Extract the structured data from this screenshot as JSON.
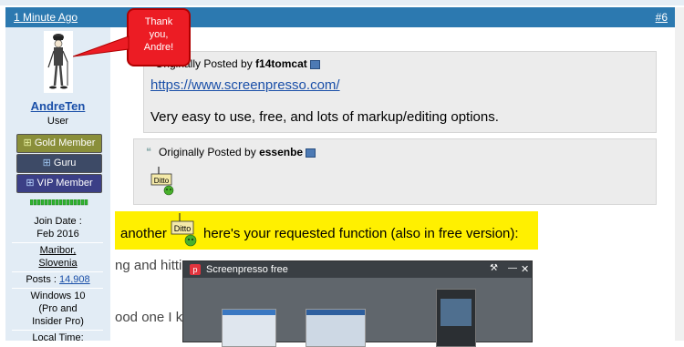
{
  "post": {
    "timestamp": "1 Minute Ago",
    "number": "#6"
  },
  "callout": {
    "lines": [
      "Thank",
      "you,",
      "Andre!"
    ]
  },
  "user": {
    "name": "AndreTen",
    "role": "User",
    "badges": [
      {
        "label": "Gold Member",
        "color": "#8a8f3a"
      },
      {
        "label": "Guru",
        "color": "#3d4a66"
      },
      {
        "label": "VIP Member",
        "color": "#3b3f86"
      }
    ],
    "join_label": "Join Date :",
    "join_value": "Feb 2016",
    "location_1": "Maribor,",
    "location_2": "Slovenia",
    "posts_label": "Posts :",
    "posts_value": "14,908",
    "os_1": "Windows 10",
    "os_2": "(Pro and",
    "os_3": "Insider Pro)",
    "local_time": "Local Time:"
  },
  "quote1": {
    "prefix": "Originally Posted by",
    "author": "f14tomcat",
    "link": "https://www.screenpresso.com/",
    "text": "Very easy to use, free, and lots of markup/editing options."
  },
  "quote2": {
    "prefix": "Originally Posted by",
    "author": "essenbe",
    "sign_text": "Ditto"
  },
  "reply": {
    "before": "another",
    "sign_text": "Ditto",
    "after": "here's your requested function (also in free version):",
    "partial_1": "ng and hitting PS",
    "partial_2": "ood one I k"
  },
  "screenshot": {
    "title": "Screenpresso free"
  }
}
